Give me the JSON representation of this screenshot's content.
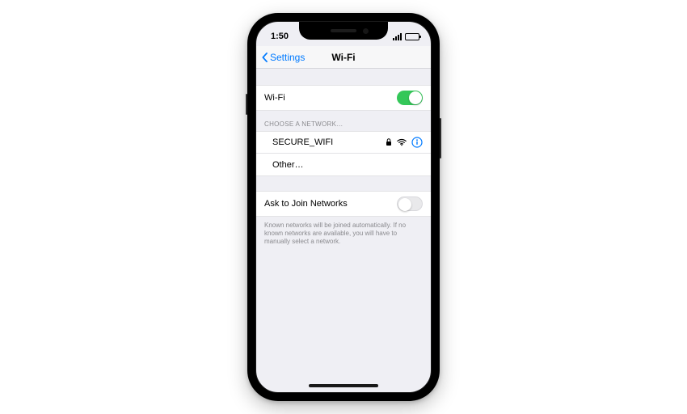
{
  "status": {
    "time": "1:50"
  },
  "nav": {
    "back_label": "Settings",
    "title": "Wi-Fi"
  },
  "wifi": {
    "toggle_label": "Wi-Fi",
    "toggle_on": true
  },
  "networks": {
    "header": "CHOOSE A NETWORK…",
    "items": [
      {
        "ssid": "SECURE_WIFI",
        "locked": true
      }
    ],
    "other_label": "Other…"
  },
  "ask_join": {
    "label": "Ask to Join Networks",
    "on": false,
    "footer": "Known networks will be joined automatically. If no known networks are available, you will have to manually select a network."
  }
}
